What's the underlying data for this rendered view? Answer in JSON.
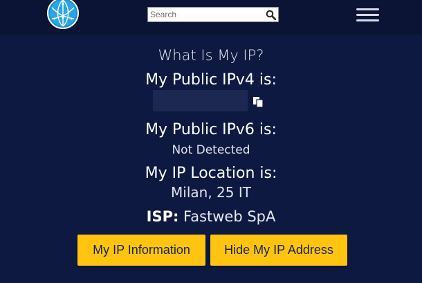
{
  "header": {
    "search": {
      "placeholder": "Search"
    },
    "logo_icon": "globe-logo",
    "menu_icon": "hamburger-menu-icon"
  },
  "main": {
    "title": "What Is My IP?",
    "ipv4_label": "My Public IPv4 is:",
    "ipv6_label": "My Public IPv6 is:",
    "ipv6_value": "Not Detected",
    "location_label": "My IP Location is:",
    "location_value": "Milan, 25 IT",
    "isp_key": "ISP:",
    "isp_value": "Fastweb SpA"
  },
  "buttons": {
    "info_label": "My IP Information",
    "hide_label": "Hide My IP Address"
  },
  "colors": {
    "background": "#0e1941",
    "header": "#0b1434",
    "button": "#fec40f"
  }
}
